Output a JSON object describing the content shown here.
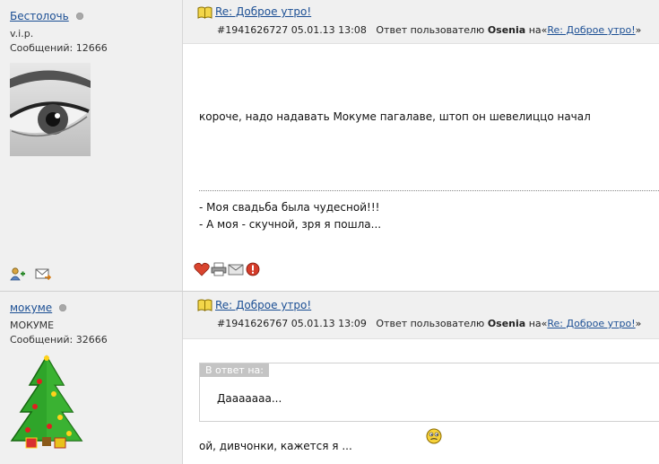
{
  "posts": [
    {
      "user": {
        "name": "Бестолочь",
        "rank": "v.i.p.",
        "messages": "Сообщений: 12666"
      },
      "title": "Re: Доброе утро!",
      "meta": {
        "id_date": "#1941626727 05.01.13 13:08",
        "reply_prefix": "Ответ пользователю",
        "author": "Osenia",
        "on": "на",
        "quote_open": "«",
        "ref_link": "Re: Доброе утро!",
        "quote_close": "»"
      },
      "body": "короче, надо надавать Мокуме пагалаве, штоп он шевелиццо начал",
      "signature": [
        "- Моя свадьба была чудесной!!!",
        "- А моя - скучной, зря я пошла..."
      ]
    },
    {
      "user": {
        "name": "мокуме",
        "rank": "МОКУМЕ",
        "messages": "Сообщений: 32666"
      },
      "title": "Re: Доброе утро!",
      "meta": {
        "id_date": "#1941626767 05.01.13 13:09",
        "reply_prefix": "Ответ пользователю",
        "author": "Osenia",
        "on": "на",
        "quote_open": "«",
        "ref_link": "Re: Доброе утро!",
        "quote_close": "»"
      },
      "quote": {
        "label": "В ответ на:",
        "text": "Дааааааа..."
      },
      "body": "ой, дивчонки, кажется я  ..."
    }
  ],
  "icons": {
    "online_status": "gray-dot-icon",
    "title_marker": "book-icon",
    "add_friend": "add-user-icon",
    "private_message": "envelope-arrow-icon",
    "like": "heart-icon",
    "print": "printer-icon",
    "send": "envelope-icon",
    "report": "warning-icon",
    "smiley": "smiley-icon"
  },
  "colors": {
    "link": "#1c4f94",
    "sidebar_bg": "#f0f0f0",
    "header_bg": "#f0f0f0",
    "quote_label_bg": "#c4c4c4"
  }
}
